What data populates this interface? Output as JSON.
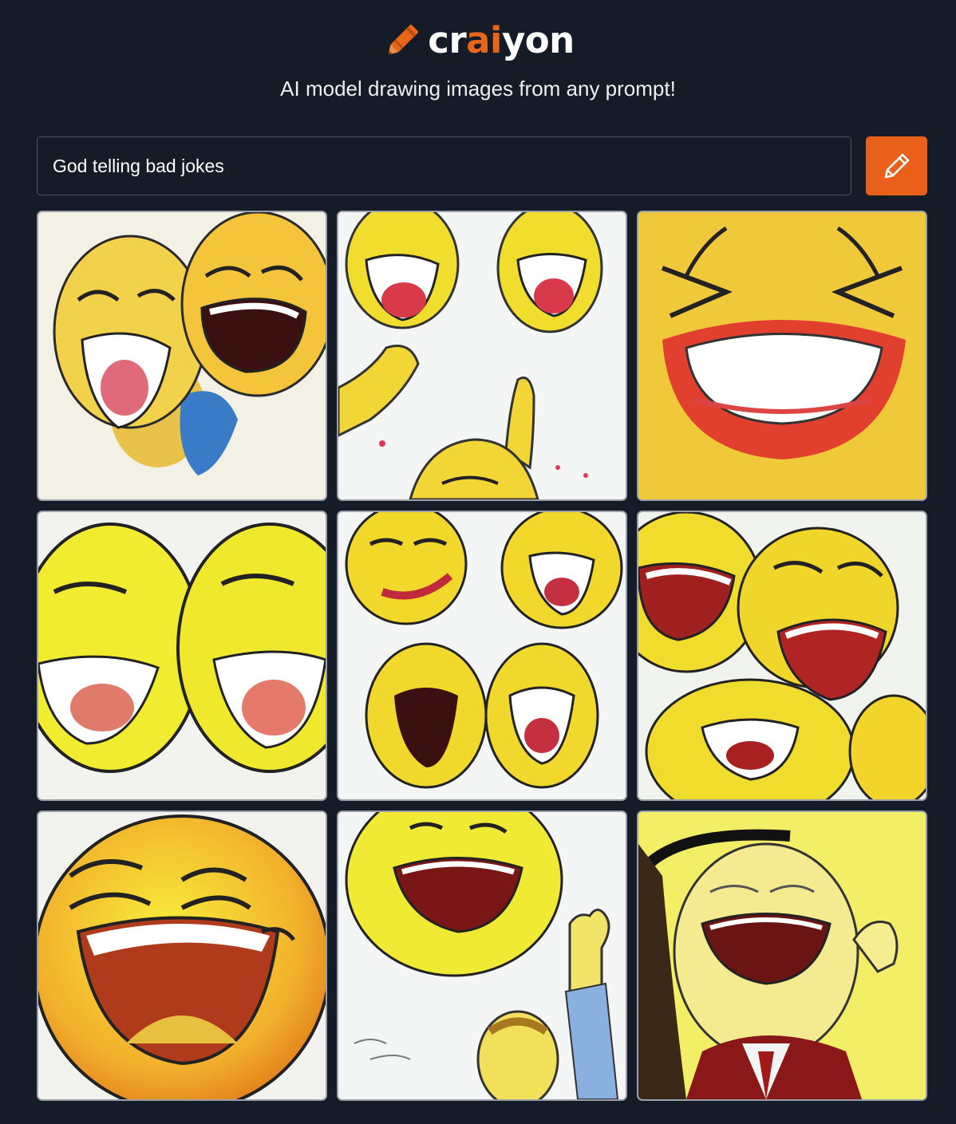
{
  "app": {
    "logo_parts": [
      "cr",
      "ai",
      "yon"
    ],
    "tagline": "AI model drawing images from any prompt!"
  },
  "search": {
    "value": "God telling bad jokes",
    "placeholder": ""
  },
  "draw_button": {
    "icon": "pencil-icon"
  },
  "colors": {
    "background": "#151b27",
    "accent": "#e8601a",
    "tile_border": "#9aa0aa",
    "emoji_yellow": "#f2e62e",
    "emoji_orange": "#f0b431"
  },
  "results": {
    "count": 9,
    "images": [
      {
        "subject": "two-laughing-emoji-faces"
      },
      {
        "subject": "laughing-emojis-with-raised-fists"
      },
      {
        "subject": "close-up-laughing-emoji"
      },
      {
        "subject": "two-laughing-emoji-faces-side-by-side"
      },
      {
        "subject": "four-small-laughing-emojis"
      },
      {
        "subject": "group-of-laughing-emojis"
      },
      {
        "subject": "large-laughing-orange-emoji"
      },
      {
        "subject": "laughing-emoji-with-raised-fist"
      },
      {
        "subject": "laughing-man-in-suit"
      }
    ]
  }
}
